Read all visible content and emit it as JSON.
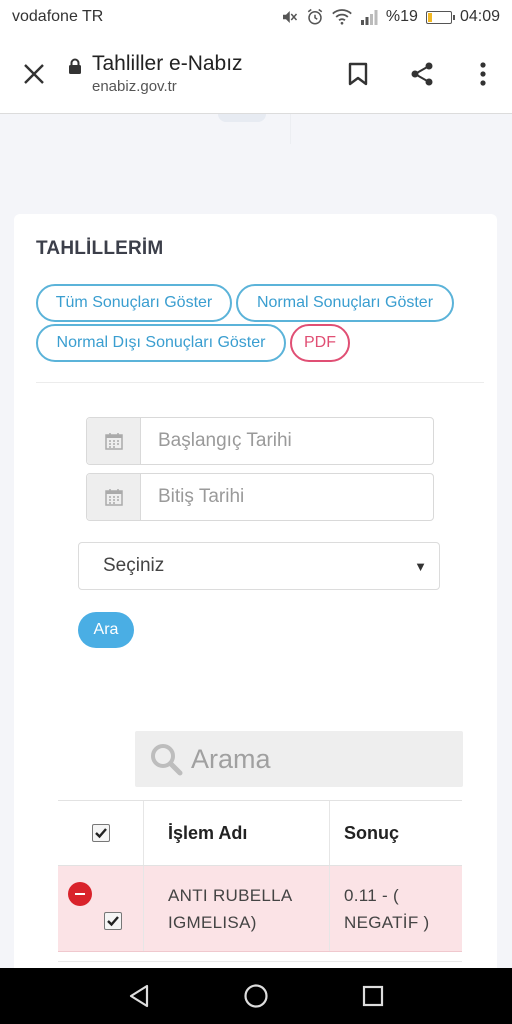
{
  "status_bar": {
    "carrier": "vodafone TR",
    "battery": "%19",
    "time": "04:09",
    "battery_level": 0.19,
    "icons": [
      "mute-icon",
      "alarm-icon",
      "wifi-icon",
      "signal-icon",
      "battery-icon"
    ]
  },
  "browser": {
    "title": "Tahliller e-Nabız",
    "url": "enabiz.gov.tr",
    "icons": [
      "close-icon",
      "lock-icon",
      "bookmark-icon",
      "share-icon",
      "more-vert-icon"
    ]
  },
  "section": {
    "title": "TAHLİLLERİM"
  },
  "filters": {
    "all": "Tüm Sonuçları Göster",
    "normal": "Normal Sonuçları Göster",
    "abnormal": "Normal Dışı Sonuçları Göster",
    "pdf": "PDF"
  },
  "dates": {
    "start_placeholder": "Başlangıç Tarihi",
    "end_placeholder": "Bitiş Tarihi"
  },
  "select": {
    "value": "Seçiniz"
  },
  "search_button": {
    "label": "Ara"
  },
  "search": {
    "placeholder": "Arama"
  },
  "table": {
    "columns": [
      "İşlem Adı",
      "Sonuç"
    ],
    "rows": [
      {
        "name": "ANTI RUBELLA IGMELISA)",
        "result": "0.11 - ( NEGATİF )",
        "checked": true
      }
    ]
  },
  "colors": {
    "accent": "#4aaee4",
    "pill_border": "#5bb3d9",
    "pdf": "#e04f74",
    "abnormal_row": "#fbe3e6",
    "remove": "#d9232b"
  }
}
